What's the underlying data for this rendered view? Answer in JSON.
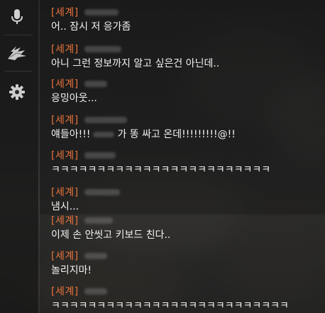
{
  "sidebar": {
    "buttons": [
      {
        "icon": "microphone-icon"
      },
      {
        "icon": "guild-emblem-icon"
      },
      {
        "icon": "gear-icon"
      }
    ]
  },
  "chat": {
    "messages": [
      {
        "channel": "[세계]",
        "text": "어.. 잠시 저 응가좀"
      },
      {
        "channel": "[세계]",
        "text": "아니 그런 정보까지 알고 싶은건 아닌데.."
      },
      {
        "channel": "[세계]",
        "text": "응밍아웃..."
      },
      {
        "channel": "[세계]",
        "text_before": "얘들아!!!",
        "text_after": "가 똥 싸고 온데!!!!!!!!!@!!"
      },
      {
        "channel": "[세계]",
        "text": "ㅋㅋㅋㅋㅋㅋㅋㅋㅋㅋㅋㅋㅋㅋㅋㅋㅋㅋㅋㅋㅋㅋㅋㅋ"
      },
      {
        "channel": "[세계]",
        "text": "냄시..."
      },
      {
        "channel": "[세계]",
        "text": "이제 손 안씻고 키보드 친다.."
      },
      {
        "channel": "[세계]",
        "text": "놀리지마!"
      },
      {
        "channel": "[세계]",
        "text": "ㅋㅋㅋㅋㅋㅋㅋㅋㅋㅋㅋㅋㅋㅋㅋㅋㅋㅋㅋㅋㅋㅋㅋㅋㅋㅋ"
      }
    ]
  }
}
